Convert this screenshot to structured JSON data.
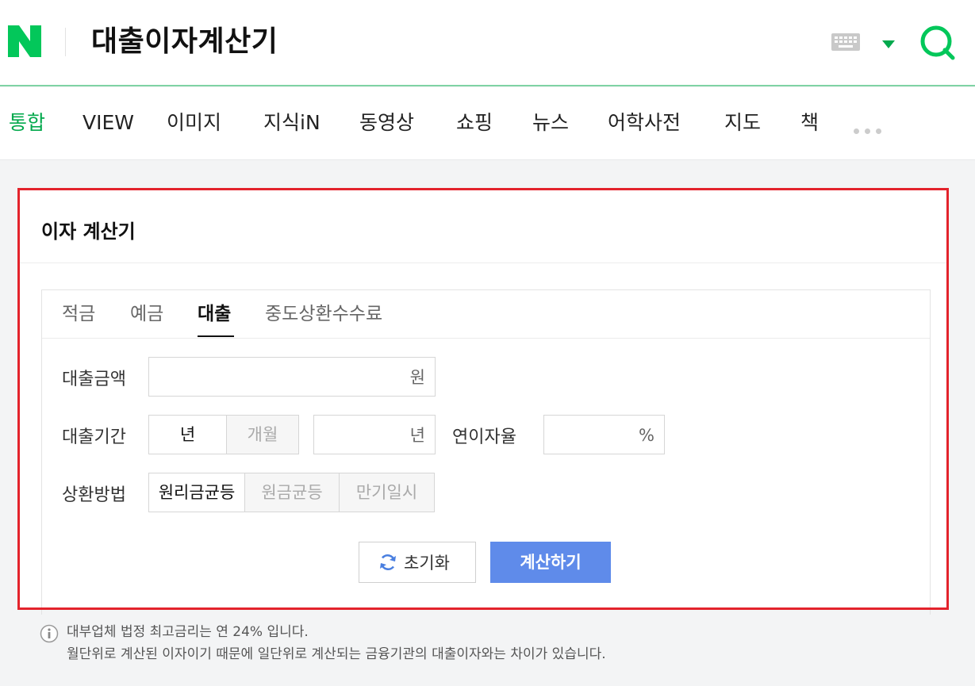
{
  "header": {
    "query": "대출이자계산기"
  },
  "tabs": [
    {
      "label": "통합",
      "active": true
    },
    {
      "label": "VIEW"
    },
    {
      "label": "이미지"
    },
    {
      "label": "지식iN"
    },
    {
      "label": "동영상"
    },
    {
      "label": "쇼핑"
    },
    {
      "label": "뉴스"
    },
    {
      "label": "어학사전"
    },
    {
      "label": "지도"
    },
    {
      "label": "책"
    }
  ],
  "card": {
    "title": "이자 계산기",
    "calc_tabs": [
      "적금",
      "예금",
      "대출",
      "중도상환수수료"
    ],
    "active_calc_tab": "대출",
    "amount": {
      "label": "대출금액",
      "value": "",
      "unit": "원"
    },
    "period": {
      "label": "대출기간",
      "toggle": [
        "년",
        "개월"
      ],
      "selected": "년",
      "value": "",
      "unit": "년"
    },
    "rate": {
      "label": "연이자율",
      "value": "",
      "unit": "%"
    },
    "method": {
      "label": "상환방법",
      "options": [
        "원리금균등",
        "원금균등",
        "만기일시"
      ],
      "selected": "원리금균등"
    },
    "reset_label": "초기화",
    "calc_label": "계산하기"
  },
  "notes": [
    "대부업체 법정 최고금리는 연 24% 입니다.",
    "월단위로 계산된 이자이기 때문에 일단위로 계산되는 금융기관의 대출이자와는 차이가 있습니다."
  ],
  "colors": {
    "brand_green": "#03a94d",
    "highlight_border": "#e3232c",
    "primary_button": "#5f8bea"
  }
}
